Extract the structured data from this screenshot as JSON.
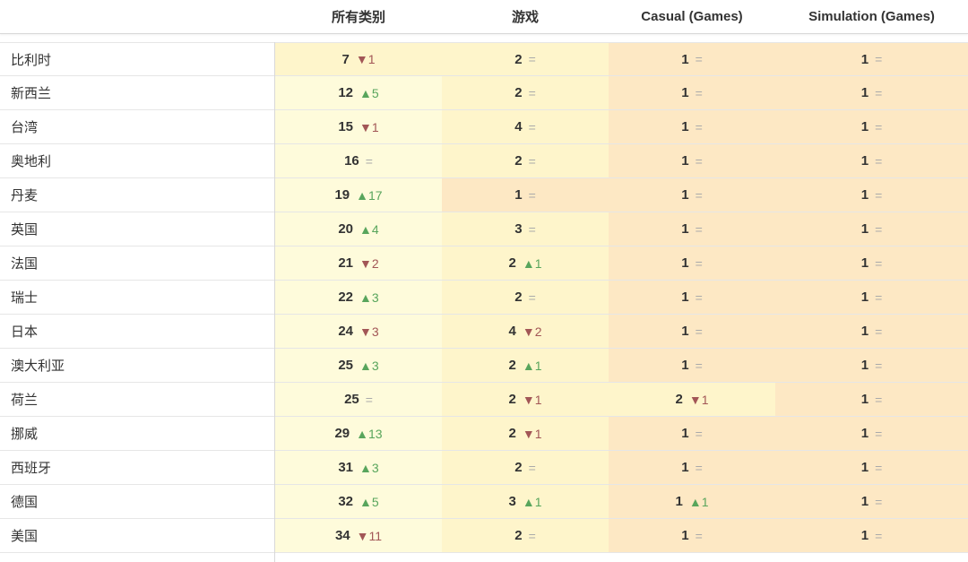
{
  "columns": [
    "",
    "所有类别",
    "游戏",
    "Casual (Games)",
    "Simulation (Games)"
  ],
  "rows": [
    {
      "country": "比利时",
      "cells": [
        {
          "rank": "7",
          "dir": "down",
          "delta": "1",
          "shade": "l2"
        },
        {
          "rank": "2",
          "dir": "same",
          "delta": "",
          "shade": "l2"
        },
        {
          "rank": "1",
          "dir": "same",
          "delta": "",
          "shade": "l3"
        },
        {
          "rank": "1",
          "dir": "same",
          "delta": "",
          "shade": "l3"
        }
      ]
    },
    {
      "country": "新西兰",
      "cells": [
        {
          "rank": "12",
          "dir": "up",
          "delta": "5",
          "shade": "l1"
        },
        {
          "rank": "2",
          "dir": "same",
          "delta": "",
          "shade": "l2"
        },
        {
          "rank": "1",
          "dir": "same",
          "delta": "",
          "shade": "l3"
        },
        {
          "rank": "1",
          "dir": "same",
          "delta": "",
          "shade": "l3"
        }
      ]
    },
    {
      "country": "台湾",
      "cells": [
        {
          "rank": "15",
          "dir": "down",
          "delta": "1",
          "shade": "l1"
        },
        {
          "rank": "4",
          "dir": "same",
          "delta": "",
          "shade": "l2"
        },
        {
          "rank": "1",
          "dir": "same",
          "delta": "",
          "shade": "l3"
        },
        {
          "rank": "1",
          "dir": "same",
          "delta": "",
          "shade": "l3"
        }
      ]
    },
    {
      "country": "奥地利",
      "cells": [
        {
          "rank": "16",
          "dir": "same",
          "delta": "",
          "shade": "l1"
        },
        {
          "rank": "2",
          "dir": "same",
          "delta": "",
          "shade": "l2"
        },
        {
          "rank": "1",
          "dir": "same",
          "delta": "",
          "shade": "l3"
        },
        {
          "rank": "1",
          "dir": "same",
          "delta": "",
          "shade": "l3"
        }
      ]
    },
    {
      "country": "丹麦",
      "cells": [
        {
          "rank": "19",
          "dir": "up",
          "delta": "17",
          "shade": "l1"
        },
        {
          "rank": "1",
          "dir": "same",
          "delta": "",
          "shade": "l3"
        },
        {
          "rank": "1",
          "dir": "same",
          "delta": "",
          "shade": "l3"
        },
        {
          "rank": "1",
          "dir": "same",
          "delta": "",
          "shade": "l3"
        }
      ]
    },
    {
      "country": "英国",
      "cells": [
        {
          "rank": "20",
          "dir": "up",
          "delta": "4",
          "shade": "l1"
        },
        {
          "rank": "3",
          "dir": "same",
          "delta": "",
          "shade": "l2"
        },
        {
          "rank": "1",
          "dir": "same",
          "delta": "",
          "shade": "l3"
        },
        {
          "rank": "1",
          "dir": "same",
          "delta": "",
          "shade": "l3"
        }
      ]
    },
    {
      "country": "法国",
      "cells": [
        {
          "rank": "21",
          "dir": "down",
          "delta": "2",
          "shade": "l1"
        },
        {
          "rank": "2",
          "dir": "up",
          "delta": "1",
          "shade": "l2"
        },
        {
          "rank": "1",
          "dir": "same",
          "delta": "",
          "shade": "l3"
        },
        {
          "rank": "1",
          "dir": "same",
          "delta": "",
          "shade": "l3"
        }
      ]
    },
    {
      "country": "瑞士",
      "cells": [
        {
          "rank": "22",
          "dir": "up",
          "delta": "3",
          "shade": "l1"
        },
        {
          "rank": "2",
          "dir": "same",
          "delta": "",
          "shade": "l2"
        },
        {
          "rank": "1",
          "dir": "same",
          "delta": "",
          "shade": "l3"
        },
        {
          "rank": "1",
          "dir": "same",
          "delta": "",
          "shade": "l3"
        }
      ]
    },
    {
      "country": "日本",
      "cells": [
        {
          "rank": "24",
          "dir": "down",
          "delta": "3",
          "shade": "l1"
        },
        {
          "rank": "4",
          "dir": "down",
          "delta": "2",
          "shade": "l2"
        },
        {
          "rank": "1",
          "dir": "same",
          "delta": "",
          "shade": "l3"
        },
        {
          "rank": "1",
          "dir": "same",
          "delta": "",
          "shade": "l3"
        }
      ]
    },
    {
      "country": "澳大利亚",
      "cells": [
        {
          "rank": "25",
          "dir": "up",
          "delta": "3",
          "shade": "l1"
        },
        {
          "rank": "2",
          "dir": "up",
          "delta": "1",
          "shade": "l2"
        },
        {
          "rank": "1",
          "dir": "same",
          "delta": "",
          "shade": "l3"
        },
        {
          "rank": "1",
          "dir": "same",
          "delta": "",
          "shade": "l3"
        }
      ]
    },
    {
      "country": "荷兰",
      "cells": [
        {
          "rank": "25",
          "dir": "same",
          "delta": "",
          "shade": "l1"
        },
        {
          "rank": "2",
          "dir": "down",
          "delta": "1",
          "shade": "l2"
        },
        {
          "rank": "2",
          "dir": "down",
          "delta": "1",
          "shade": "l2"
        },
        {
          "rank": "1",
          "dir": "same",
          "delta": "",
          "shade": "l3"
        }
      ]
    },
    {
      "country": "挪威",
      "cells": [
        {
          "rank": "29",
          "dir": "up",
          "delta": "13",
          "shade": "l1"
        },
        {
          "rank": "2",
          "dir": "down",
          "delta": "1",
          "shade": "l2"
        },
        {
          "rank": "1",
          "dir": "same",
          "delta": "",
          "shade": "l3"
        },
        {
          "rank": "1",
          "dir": "same",
          "delta": "",
          "shade": "l3"
        }
      ]
    },
    {
      "country": "西班牙",
      "cells": [
        {
          "rank": "31",
          "dir": "up",
          "delta": "3",
          "shade": "l1"
        },
        {
          "rank": "2",
          "dir": "same",
          "delta": "",
          "shade": "l2"
        },
        {
          "rank": "1",
          "dir": "same",
          "delta": "",
          "shade": "l3"
        },
        {
          "rank": "1",
          "dir": "same",
          "delta": "",
          "shade": "l3"
        }
      ]
    },
    {
      "country": "德国",
      "cells": [
        {
          "rank": "32",
          "dir": "up",
          "delta": "5",
          "shade": "l1"
        },
        {
          "rank": "3",
          "dir": "up",
          "delta": "1",
          "shade": "l2"
        },
        {
          "rank": "1",
          "dir": "up",
          "delta": "1",
          "shade": "l3"
        },
        {
          "rank": "1",
          "dir": "same",
          "delta": "",
          "shade": "l3"
        }
      ]
    },
    {
      "country": "美国",
      "cells": [
        {
          "rank": "34",
          "dir": "down",
          "delta": "11",
          "shade": "l1"
        },
        {
          "rank": "2",
          "dir": "same",
          "delta": "",
          "shade": "l2"
        },
        {
          "rank": "1",
          "dir": "same",
          "delta": "",
          "shade": "l3"
        },
        {
          "rank": "1",
          "dir": "same",
          "delta": "",
          "shade": "l3"
        }
      ]
    }
  ],
  "symbols": {
    "up": "▲",
    "down": "▼",
    "same": "="
  },
  "colors": {
    "up": "#58a55c",
    "down": "#a25656",
    "same": "#aaaaaa",
    "l1": "#fefbdb",
    "l2": "#fef5cb",
    "l3": "#fde8c4"
  }
}
